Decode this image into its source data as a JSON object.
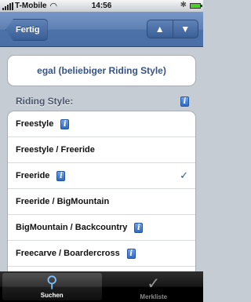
{
  "status_bar": {
    "carrier": "T-Mobile",
    "time": "14:56",
    "wifi_icon": "wifi-icon",
    "bluetooth_icon": "bluetooth-icon",
    "battery_icon": "battery-icon"
  },
  "nav": {
    "back_label": "Fertig",
    "prev_glyph": "▲",
    "next_glyph": "▼"
  },
  "selected_value": "egal (beliebiger Riding Style)",
  "section": {
    "title": "Riding Style:",
    "info_glyph": "i"
  },
  "rows": [
    {
      "label": "Freestyle",
      "info": "i",
      "checked": ""
    },
    {
      "label": "Freestyle / Freeride",
      "info": "",
      "checked": ""
    },
    {
      "label": "Freeride",
      "info": "i",
      "checked": "✓"
    },
    {
      "label": "Freeride / BigMountain",
      "info": "",
      "checked": ""
    },
    {
      "label": "BigMountain / Backcountry",
      "info": "i",
      "checked": ""
    },
    {
      "label": "Freecarve / Boardercross",
      "info": "i",
      "checked": ""
    }
  ],
  "tabs": [
    {
      "label": "Suchen",
      "icon": "search-icon",
      "glyph": "⚲",
      "active": true
    },
    {
      "label": "Merkliste",
      "icon": "checkmark-icon",
      "glyph": "✓",
      "active": false
    }
  ],
  "colors": {
    "nav_blue": "#5e80b4",
    "accent_text": "#385487",
    "background": "#c5ccd4"
  }
}
